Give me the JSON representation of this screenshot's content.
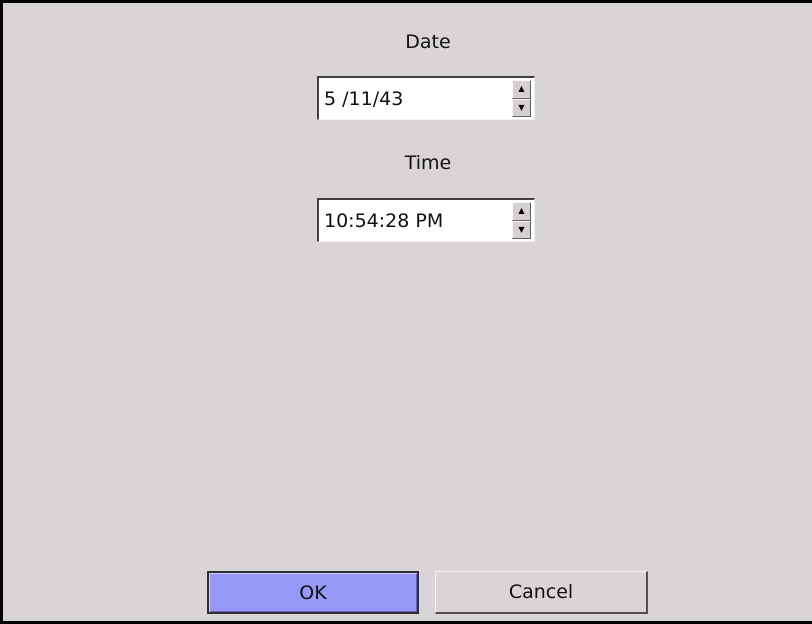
{
  "dialog": {
    "date_label": "Date",
    "date_value": "5 /11/43",
    "time_label": "Time",
    "time_value": "10:54:28 PM",
    "ok_label": "OK",
    "cancel_label": "Cancel",
    "spin_up_icon": "▲",
    "spin_down_icon": "▼"
  },
  "colors": {
    "dialog_background": "#d8d4d8",
    "ok_button_background": "#9898f8",
    "field_background": "#ffffff"
  }
}
